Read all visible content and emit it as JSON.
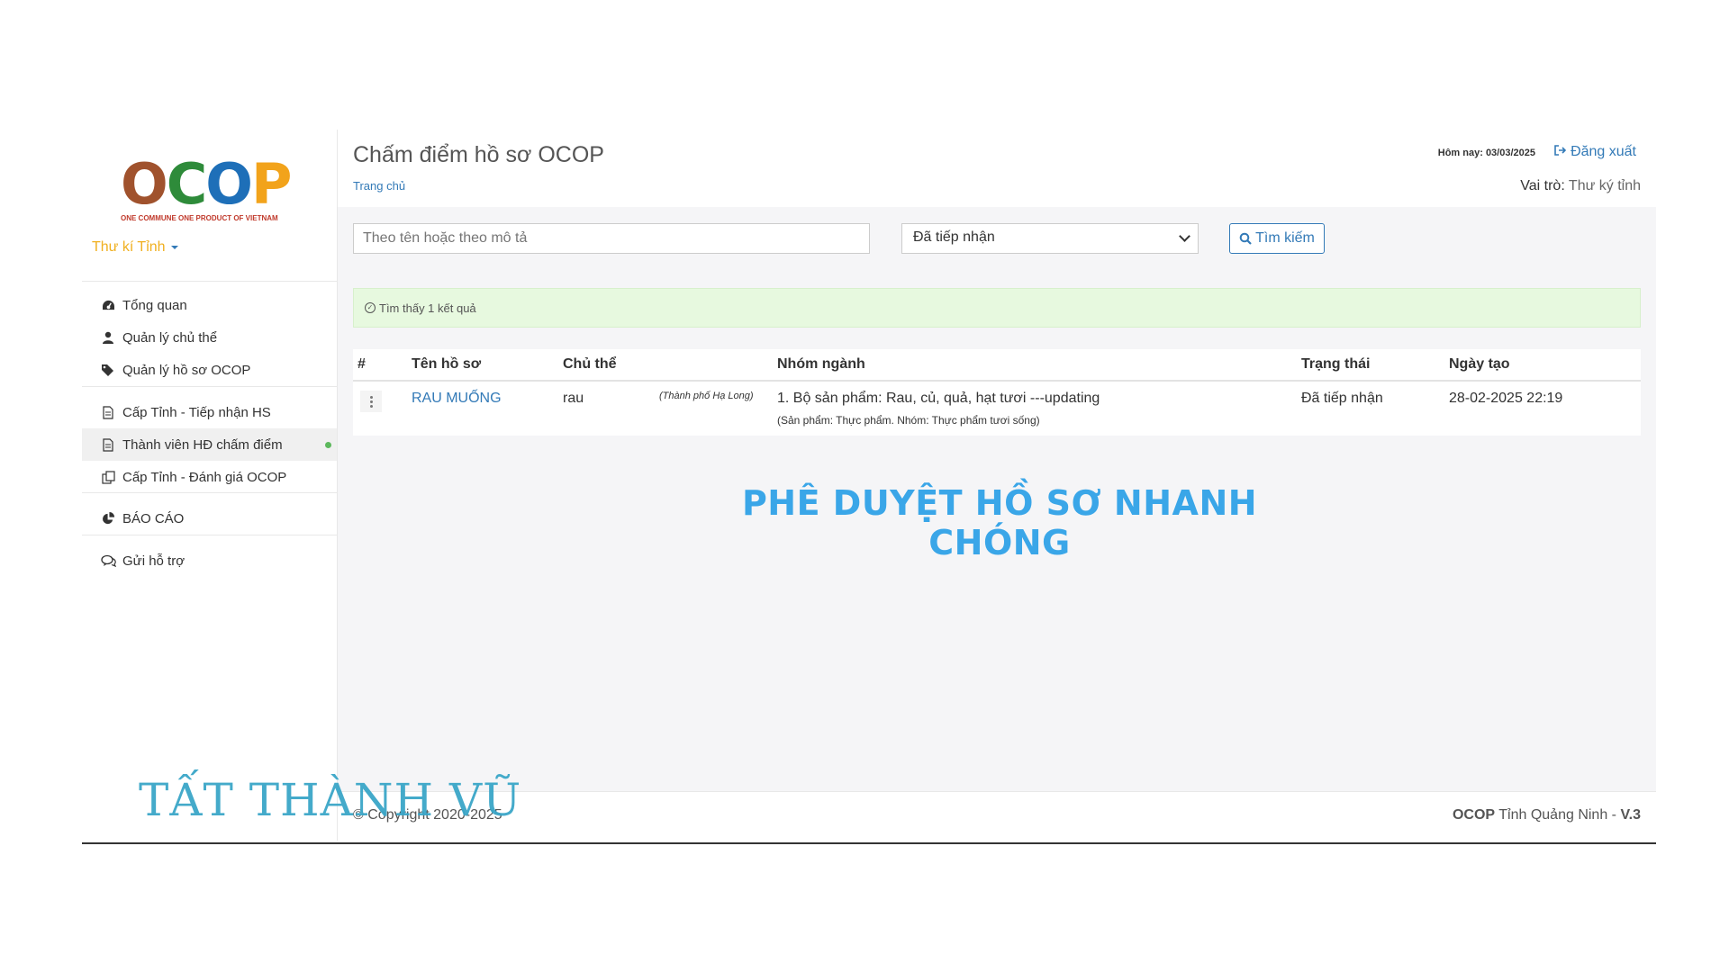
{
  "app": {
    "title": "Chấm điểm hồ sơ OCOP",
    "breadcrumb": "Trang chủ",
    "today": "Hôm nay: 03/03/2025",
    "logout": "Đăng xuất",
    "role_label": "Vai trò:",
    "role_value": "Thư ký tỉnh"
  },
  "logo": {
    "word": "OCOP",
    "tagline": "ONE COMMUNE ONE PRODUCT OF VIETNAM"
  },
  "sidebar": {
    "user": "Thư kí Tỉnh",
    "groups": [
      [
        {
          "label": "Tổng quan",
          "icon": "dashboard-icon"
        },
        {
          "label": "Quản lý chủ thể",
          "icon": "user-icon"
        },
        {
          "label": "Quản lý hồ sơ OCOP",
          "icon": "tags-icon"
        }
      ],
      [
        {
          "label": "Cấp Tỉnh - Tiếp nhận HS",
          "icon": "document-icon"
        },
        {
          "label": "Thành viên HĐ chấm điểm",
          "icon": "document-icon",
          "active": true
        },
        {
          "label": "Cấp Tỉnh - Đánh giá OCOP",
          "icon": "copy-icon"
        }
      ],
      [
        {
          "label": "BÁO CÁO",
          "icon": "pie-chart-icon"
        }
      ],
      [
        {
          "label": "Gửi hỗ trợ",
          "icon": "chat-icon"
        }
      ]
    ]
  },
  "filters": {
    "search_placeholder": "Theo tên hoặc theo mô tả",
    "status_selected": "Đã tiếp nhận",
    "search_button": "Tìm kiếm"
  },
  "alert": "Tìm thấy 1 kết quả",
  "table": {
    "headers": [
      "#",
      "Tên hồ sơ",
      "Chủ thể",
      "Nhóm ngành",
      "Trạng thái",
      "Ngày tạo"
    ],
    "rows": [
      {
        "name": "RAU MUỐNG",
        "owner": "rau",
        "owner_location": "(Thành phố Hạ Long)",
        "group": "1. Bộ sản phẩm: Rau, củ, quả, hạt tươi ---updating",
        "group_detail": "(Sản phẩm: Thực phẩm. Nhóm: Thực phẩm tươi sống)",
        "status": "Đã tiếp nhận",
        "created": "28-02-2025 22:19"
      }
    ]
  },
  "banner": "PHÊ DUYỆT HỒ SƠ NHANH CHÓNG",
  "footer": {
    "copyright": "© Copyright 2020-2025",
    "brand": "OCOP",
    "province": " Tỉnh Quảng Ninh - ",
    "version": "V.3"
  },
  "watermark": "TẤT THÀNH VŨ",
  "colors": {
    "accent": "#337ab7",
    "banner": "#3aa6e8",
    "user_role": "#f0b020",
    "alert_bg": "#e7f9df"
  }
}
